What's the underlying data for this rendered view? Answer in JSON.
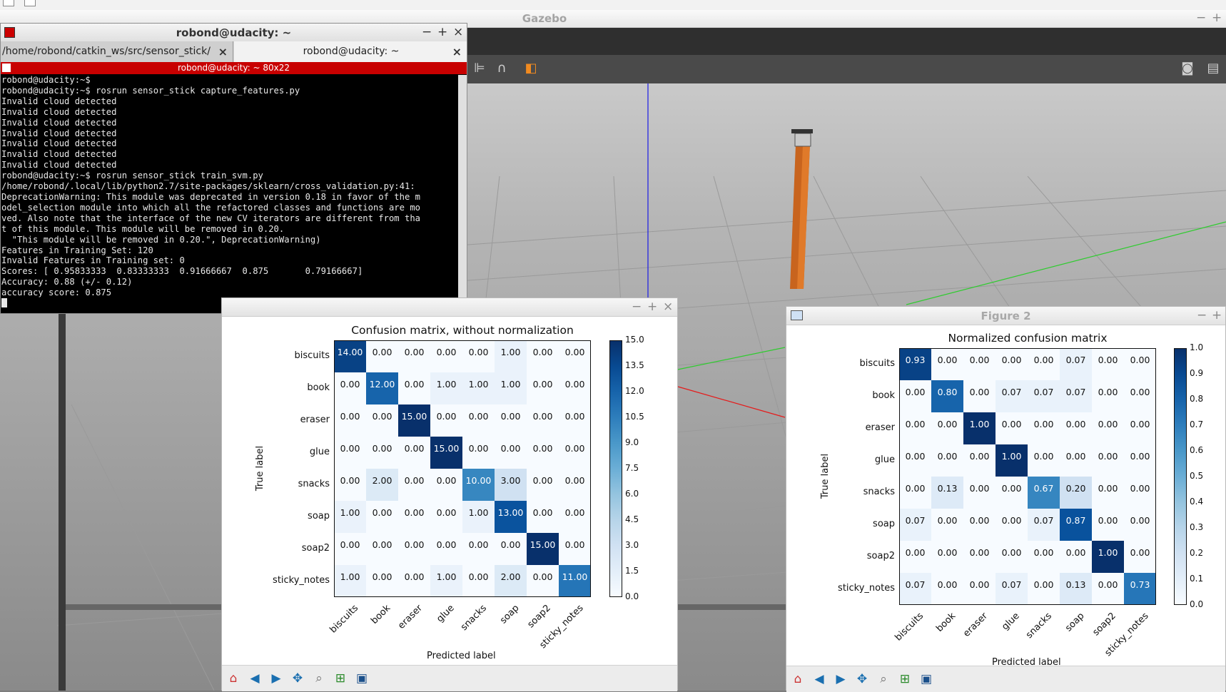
{
  "gazebo": {
    "title": "Gazebo",
    "controls": {
      "minimize": "−",
      "maximize": "+"
    }
  },
  "terminal": {
    "title": "robond@udacity: ~",
    "controls": {
      "minimize": "−",
      "maximize": "+",
      "close": "×"
    },
    "tabs": [
      {
        "label": "/home/robond/catkin_ws/src/sensor_stick/",
        "close": "×"
      },
      {
        "label": "robond@udacity: ~",
        "close": "×"
      }
    ],
    "banner": "robond@udacity: ~ 80x22",
    "lines": [
      "robond@udacity:~$",
      "robond@udacity:~$ rosrun sensor_stick capture_features.py",
      "Invalid cloud detected",
      "Invalid cloud detected",
      "Invalid cloud detected",
      "Invalid cloud detected",
      "Invalid cloud detected",
      "Invalid cloud detected",
      "Invalid cloud detected",
      "robond@udacity:~$ rosrun sensor_stick train_svm.py",
      "/home/robond/.local/lib/python2.7/site-packages/sklearn/cross_validation.py:41:",
      "DeprecationWarning: This module was deprecated in version 0.18 in favor of the m",
      "odel_selection module into which all the refactored classes and functions are mo",
      "ved. Also note that the interface of the new CV iterators are different from tha",
      "t of this module. This module will be removed in 0.20.",
      "  \"This module will be removed in 0.20.\", DeprecationWarning)",
      "Features in Training Set: 120",
      "Invalid Features in Training set: 0",
      "Scores: [ 0.95833333  0.83333333  0.91666667  0.875       0.79166667]",
      "Accuracy: 0.88 (+/- 0.12)",
      "accuracy score: 0.875"
    ]
  },
  "figure1": {
    "window_title": "",
    "controls": {
      "minimize": "−",
      "maximize": "+",
      "close": "×"
    },
    "chart_data": {
      "type": "heatmap",
      "title": "Confusion matrix, without normalization",
      "xlabel": "Predicted label",
      "ylabel": "True label",
      "labels": [
        "biscuits",
        "book",
        "eraser",
        "glue",
        "snacks",
        "soap",
        "soap2",
        "sticky_notes"
      ],
      "values": [
        [
          14,
          0,
          0,
          0,
          0,
          1,
          0,
          0
        ],
        [
          0,
          12,
          0,
          1,
          1,
          1,
          0,
          0
        ],
        [
          0,
          0,
          15,
          0,
          0,
          0,
          0,
          0
        ],
        [
          0,
          0,
          0,
          15,
          0,
          0,
          0,
          0
        ],
        [
          0,
          2,
          0,
          0,
          10,
          3,
          0,
          0
        ],
        [
          1,
          0,
          0,
          0,
          1,
          13,
          0,
          0
        ],
        [
          0,
          0,
          0,
          0,
          0,
          0,
          15,
          0
        ],
        [
          1,
          0,
          0,
          1,
          0,
          2,
          0,
          11
        ]
      ],
      "value_format": "0.00",
      "colormap": "Blues",
      "vmin": 0,
      "vmax": 15,
      "colorbar_ticks": [
        "0.0",
        "1.5",
        "3.0",
        "4.5",
        "6.0",
        "7.5",
        "9.0",
        "10.5",
        "12.0",
        "13.5",
        "15.0"
      ]
    }
  },
  "figure2": {
    "window_title": "Figure 2",
    "controls": {
      "minimize": "−",
      "maximize": "+"
    },
    "chart_data": {
      "type": "heatmap",
      "title": "Normalized confusion matrix",
      "xlabel": "Predicted label",
      "ylabel": "True label",
      "labels": [
        "biscuits",
        "book",
        "eraser",
        "glue",
        "snacks",
        "soap",
        "soap2",
        "sticky_notes"
      ],
      "values": [
        [
          0.93,
          0,
          0,
          0,
          0,
          0.07,
          0,
          0
        ],
        [
          0,
          0.8,
          0,
          0.07,
          0.07,
          0.07,
          0,
          0
        ],
        [
          0,
          0,
          1.0,
          0,
          0,
          0,
          0,
          0
        ],
        [
          0,
          0,
          0,
          1.0,
          0,
          0,
          0,
          0
        ],
        [
          0,
          0.13,
          0,
          0,
          0.67,
          0.2,
          0,
          0
        ],
        [
          0.07,
          0,
          0,
          0,
          0.07,
          0.87,
          0,
          0
        ],
        [
          0,
          0,
          0,
          0,
          0,
          0,
          1.0,
          0
        ],
        [
          0.07,
          0,
          0,
          0.07,
          0,
          0.13,
          0,
          0.73
        ]
      ],
      "value_format": "0.00",
      "colormap": "Blues",
      "vmin": 0,
      "vmax": 1,
      "colorbar_ticks": [
        "0.0",
        "0.1",
        "0.2",
        "0.3",
        "0.4",
        "0.5",
        "0.6",
        "0.7",
        "0.8",
        "0.9",
        "1.0"
      ]
    }
  },
  "toolbar_icons": [
    "home-icon",
    "back-arrow-icon",
    "forward-arrow-icon",
    "pan-icon",
    "zoom-icon",
    "configure-subplots-icon",
    "save-icon"
  ],
  "colors": {
    "terminal_banner": "#c80000",
    "gazebo_toolbar": "#4a4a4a",
    "gazebo_menubar": "#2f2f2f"
  }
}
